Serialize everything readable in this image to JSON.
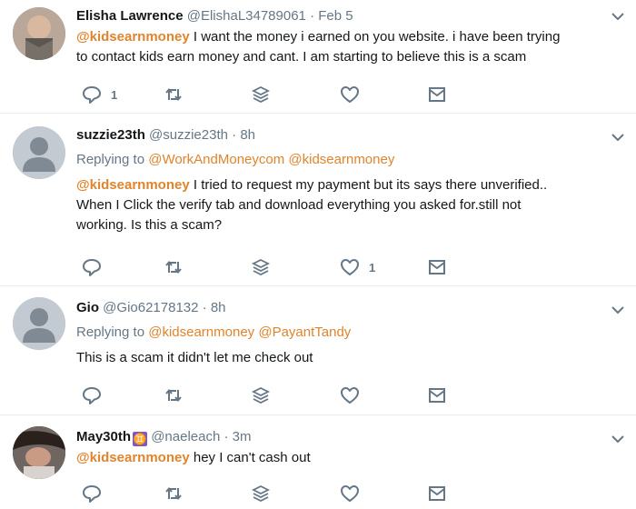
{
  "tweets": [
    {
      "name": "Elisha Lawrence",
      "handle": "@ElishaL34789061",
      "time": "Feb 5",
      "text_mention": "@kidsearnmoney",
      "text_1": " I want the money i earned on you website. i have been trying",
      "text_2": "to contact kids earn money and cant. I am starting to believe this is a scam",
      "reply_count": "1"
    },
    {
      "name": "suzzie23th",
      "handle": "@suzzie23th",
      "time": "8h",
      "replying_to": "Replying to",
      "reply_link_1": "@WorkAndMoneycom",
      "reply_link_2": "@kidsearnmoney",
      "text_mention": "@kidsearnmoney",
      "text_1": " I tried to request my payment but its says there unverified..",
      "text_2": "When I Click the verify tab and download everything you asked for.still not",
      "text_3": "working. Is this a scam?",
      "like_count": "1"
    },
    {
      "name": "Gio",
      "handle": "@Gio62178132",
      "time": "8h",
      "replying_to": "Replying to",
      "reply_link_1": "@kidsearnmoney",
      "reply_link_2": "@PayantTandy",
      "text_1": "This is a scam it didn't let me check out"
    },
    {
      "name": "May30th",
      "badge": "♊",
      "handle": "@naeleach",
      "time": "3m",
      "text_mention": "@kidsearnmoney",
      "text_1": " hey I can't cash out"
    }
  ],
  "separator": "·",
  "icons": [
    "reply-icon",
    "retweet-icon",
    "stack-icon",
    "heart-icon",
    "message-icon",
    "chevron-down-icon"
  ],
  "colors": {
    "mention": "#e0842d",
    "muted": "#657786",
    "text": "#14171a",
    "badge": "#7e57c2"
  }
}
